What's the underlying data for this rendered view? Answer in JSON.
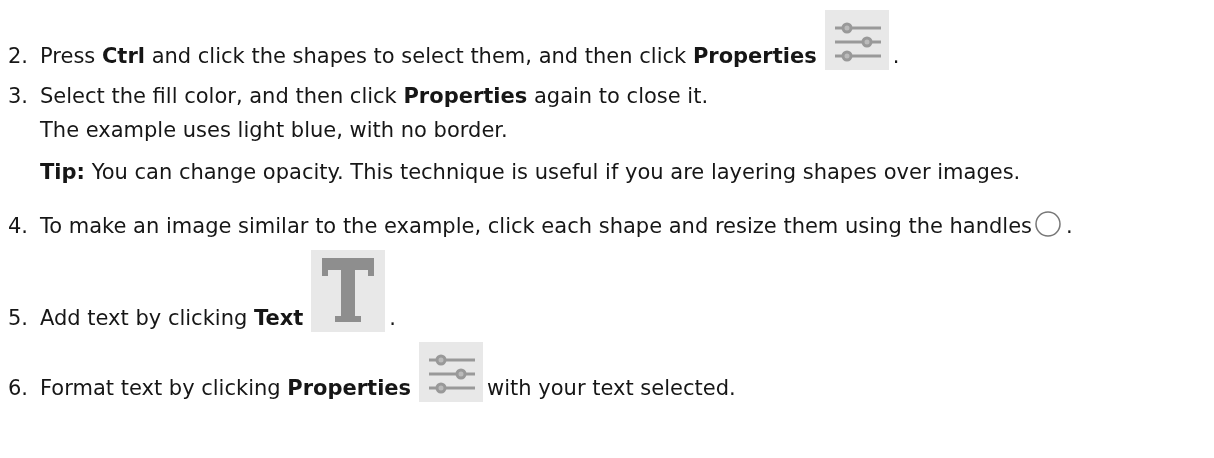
{
  "steps": [
    {
      "number": "2.",
      "parts": [
        {
          "kind": "text",
          "text": "Press **Ctrl** and click the shapes to select them, and then click **Properties**"
        },
        {
          "kind": "sliders"
        },
        {
          "kind": "text",
          "text": "."
        }
      ]
    },
    {
      "number": "3.",
      "parts": [
        {
          "kind": "text",
          "text": "Select the fill color, and then click **Properties** again to close it."
        }
      ],
      "notes": [
        {
          "kind": "plain",
          "text": "The example uses light blue, with no border."
        },
        {
          "kind": "tip",
          "text": "**Tip:** You can change opacity. This technique is useful if you are layering shapes over images."
        }
      ]
    },
    {
      "number": "4.",
      "parts": [
        {
          "kind": "text",
          "text": "To make an image similar to the example, click each shape and resize them using the handles"
        },
        {
          "kind": "circle"
        },
        {
          "kind": "text",
          "text": "."
        }
      ]
    },
    {
      "number": "5.",
      "parts": [
        {
          "kind": "text",
          "text": "Add text by clicking **Text**"
        },
        {
          "kind": "glyph"
        },
        {
          "kind": "text",
          "text": "."
        }
      ]
    },
    {
      "number": "6.",
      "parts": [
        {
          "kind": "text",
          "text": "Format text by clicking **Properties**"
        },
        {
          "kind": "sliders"
        },
        {
          "kind": "text",
          "text": "with your text selected."
        }
      ]
    }
  ]
}
